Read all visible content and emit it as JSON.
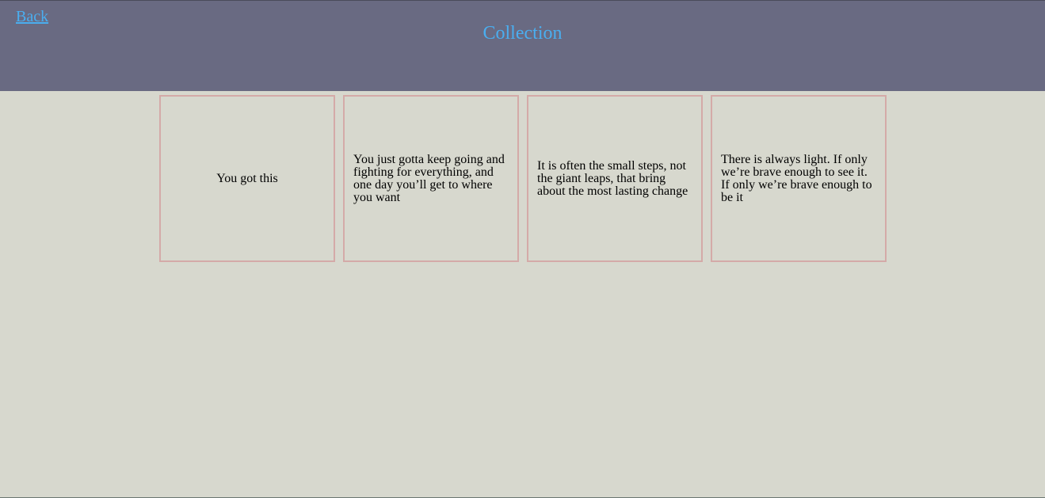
{
  "header": {
    "back_label": "Back",
    "title": "Collection"
  },
  "colors": {
    "header_bg": "#696a82",
    "page_bg": "#d7d8ce",
    "accent": "#4aaef0",
    "card_border": "#d4aaa8"
  },
  "cards": [
    {
      "text": "You got this"
    },
    {
      "text": "You just gotta keep going and fighting for everything, and one day you’ll get to where you want"
    },
    {
      "text": "It is often the small steps, not the giant leaps, that bring about the most lasting change"
    },
    {
      "text": "There is always light. If only we’re brave enough to see it. If only we’re brave enough to be it"
    }
  ]
}
